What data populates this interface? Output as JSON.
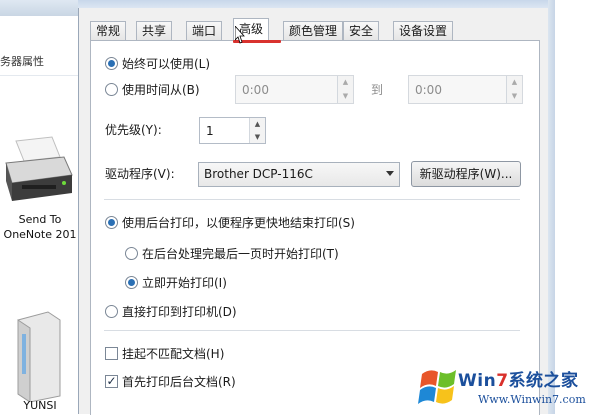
{
  "background": {
    "breadcrumb": "务器属性",
    "devices": [
      {
        "label_line1": "Send To",
        "label_line2": "OneNote 201"
      },
      {
        "label": "YUNSI"
      }
    ]
  },
  "tabs": [
    {
      "label": "常规",
      "active": false
    },
    {
      "label": "共享",
      "active": false
    },
    {
      "label": "端口",
      "active": false
    },
    {
      "label": "高级",
      "active": true
    },
    {
      "label": "颜色管理",
      "active": false
    },
    {
      "label": "安全",
      "active": false
    },
    {
      "label": "设备设置",
      "active": false
    }
  ],
  "availability": {
    "always_label": "始终可以使用(L)",
    "always_selected": true,
    "time_label": "使用时间从(B)",
    "time_selected": false,
    "from_value": "0:00",
    "to_label": "到",
    "to_value": "0:00"
  },
  "priority": {
    "label": "优先级(Y):",
    "value": "1"
  },
  "driver": {
    "label": "驱动程序(V):",
    "selected": "Brother DCP-116C",
    "new_driver_button": "新驱动程序(W)..."
  },
  "spooling": {
    "spool_label": "使用后台打印，以便程序更快地结束打印(S)",
    "spool_selected": true,
    "after_last_page_label": "在后台处理完最后一页时开始打印(T)",
    "after_last_page_selected": false,
    "immediately_label": "立即开始打印(I)",
    "immediately_selected": true,
    "direct_label": "直接打印到打印机(D)",
    "direct_selected": false
  },
  "checkboxes": {
    "hold_mismatched_label": "挂起不匹配文档(H)",
    "hold_mismatched_checked": false,
    "print_spooled_first_label": "首先打印后台文档(R)",
    "print_spooled_first_checked": true
  },
  "watermark": {
    "brand_prefix": "Win",
    "brand_num": "7",
    "brand_suffix": "系统之家",
    "url": "Www.Winwin7.com"
  },
  "colors": {
    "accent": "#2a6fb4",
    "underline": "#d9322e",
    "brand": "#1b4f9c"
  }
}
